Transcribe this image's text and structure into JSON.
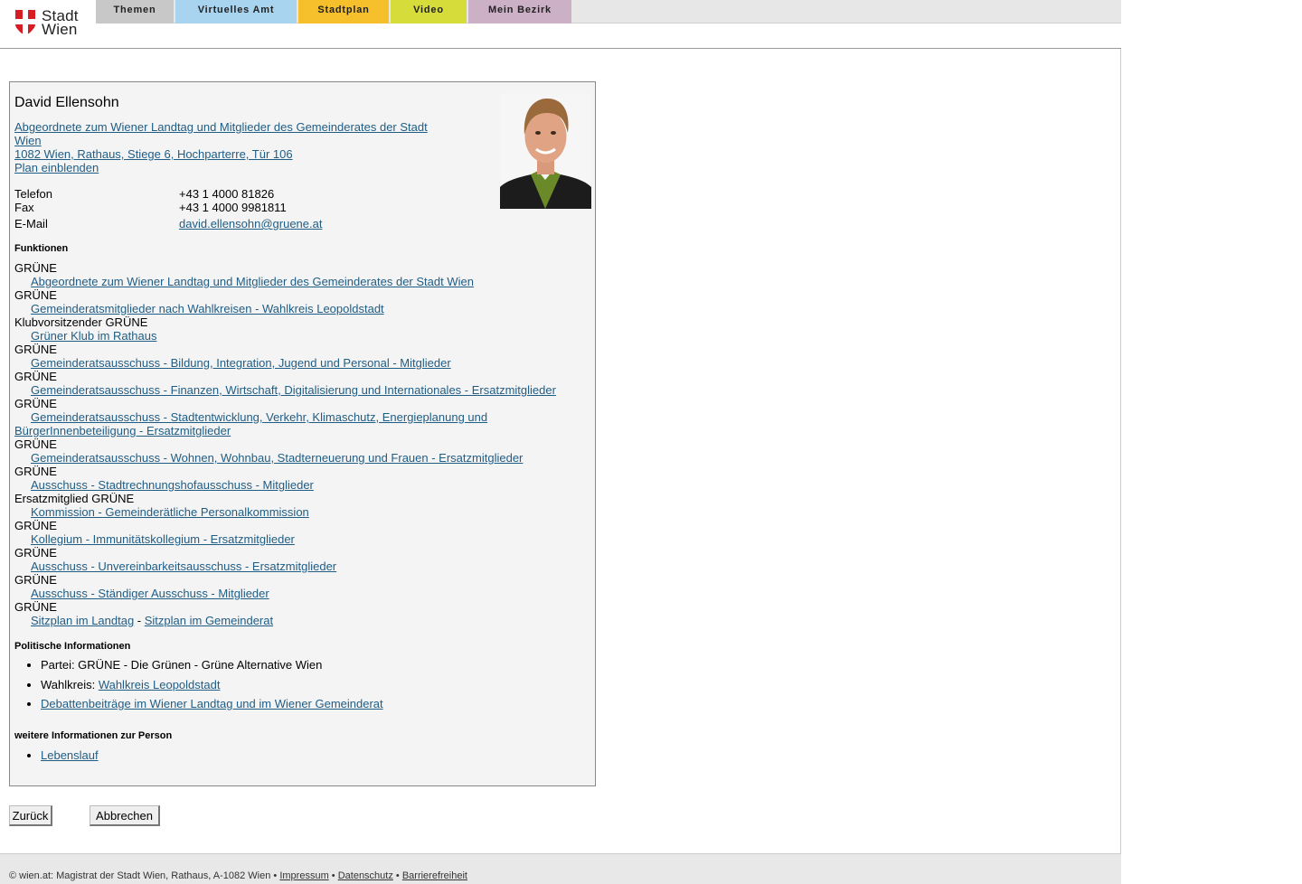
{
  "header": {
    "logo_line1": "Stadt",
    "logo_line2": "Wien",
    "brand_color": "#d61d23",
    "nav": [
      {
        "label": "Themen",
        "color": "#c8c8c8"
      },
      {
        "label": "Virtuelles Amt",
        "color": "#a8d4f0"
      },
      {
        "label": "Stadtplan",
        "color": "#f5c02c"
      },
      {
        "label": "Video",
        "color": "#d6dc3a"
      },
      {
        "label": "Mein Bezirk",
        "color": "#ccb0c6"
      }
    ]
  },
  "person": {
    "name": "David Ellensohn",
    "role_link_line1": "Abgeordnete zum Wiener Landtag und Mitglieder des Gemeinderates der Stadt",
    "role_link_line2": "Wien",
    "address": "1082 Wien, Rathaus, Stiege 6, Hochparterre, Tür 106",
    "plan_link": "Plan einblenden",
    "contact": {
      "phone_label": "Telefon",
      "phone": "+43 1 4000 81826",
      "fax_label": "Fax",
      "fax": "+43 1 4000 9981811",
      "email_label": "E-Mail",
      "email": "david.ellensohn@gruene.at"
    }
  },
  "funktionen": {
    "heading": "Funktionen",
    "items": [
      {
        "role": "GRÜNE",
        "link": "Abgeordnete zum Wiener Landtag und Mitglieder des Gemeinderates der Stadt Wien"
      },
      {
        "role": "GRÜNE",
        "link": "Gemeinderatsmitglieder nach Wahlkreisen - Wahlkreis Leopoldstadt"
      },
      {
        "role": "Klubvorsitzender GRÜNE",
        "link": "Grüner Klub im Rathaus"
      },
      {
        "role": "GRÜNE",
        "link": "Gemeinderatsausschuss - Bildung, Integration, Jugend und Personal - Mitglieder"
      },
      {
        "role": "GRÜNE",
        "link": "Gemeinderatsausschuss - Finanzen, Wirtschaft, Digitalisierung und Internationales - Ersatzmitglieder"
      },
      {
        "role": "GRÜNE",
        "link": "Gemeinderatsausschuss - Stadtentwicklung, Verkehr, Klimaschutz, Energieplanung und",
        "link_cont": "BürgerInnenbeteiligung - Ersatzmitglieder"
      },
      {
        "role": "GRÜNE",
        "link": "Gemeinderatsausschuss - Wohnen, Wohnbau, Stadterneuerung und Frauen - Ersatzmitglieder"
      },
      {
        "role": "GRÜNE",
        "link": "Ausschuss - Stadtrechnungshofausschuss - Mitglieder"
      },
      {
        "role": "Ersatzmitglied GRÜNE",
        "link": "Kommission - Gemeinderätliche Personalkommission"
      },
      {
        "role": "GRÜNE",
        "link": "Kollegium - Immunitätskollegium - Ersatzmitglieder"
      },
      {
        "role": "GRÜNE",
        "link": "Ausschuss - Unvereinbarkeitsausschuss - Ersatzmitglieder"
      },
      {
        "role": "GRÜNE",
        "link": "Ausschuss - Ständiger Ausschuss - Mitglieder"
      },
      {
        "role": "GRÜNE",
        "link": "Sitzplan im Landtag",
        "sep": " - ",
        "link2": "Sitzplan im Gemeinderat"
      }
    ]
  },
  "politische": {
    "heading": "Politische Informationen",
    "partei": "Partei: GRÜNE - Die Grünen - Grüne Alternative Wien",
    "wahlkreis_label": "Wahlkreis: ",
    "wahlkreis_link": "Wahlkreis Leopoldstadt",
    "debatten_link": "Debattenbeiträge im Wiener Landtag und im Wiener Gemeinderat"
  },
  "weitere": {
    "heading": "weitere Informationen zur Person",
    "lebenslauf": "Lebenslauf"
  },
  "buttons": {
    "back": "Zurück",
    "cancel": "Abbrechen"
  },
  "footer": {
    "text": "© wien.at: Magistrat der Stadt Wien, Rathaus, A-1082 Wien • ",
    "impressum": "Impressum",
    "sep": " • ",
    "datenschutz": "Datenschutz",
    "barrierefreiheit": "Barrierefreiheit"
  }
}
